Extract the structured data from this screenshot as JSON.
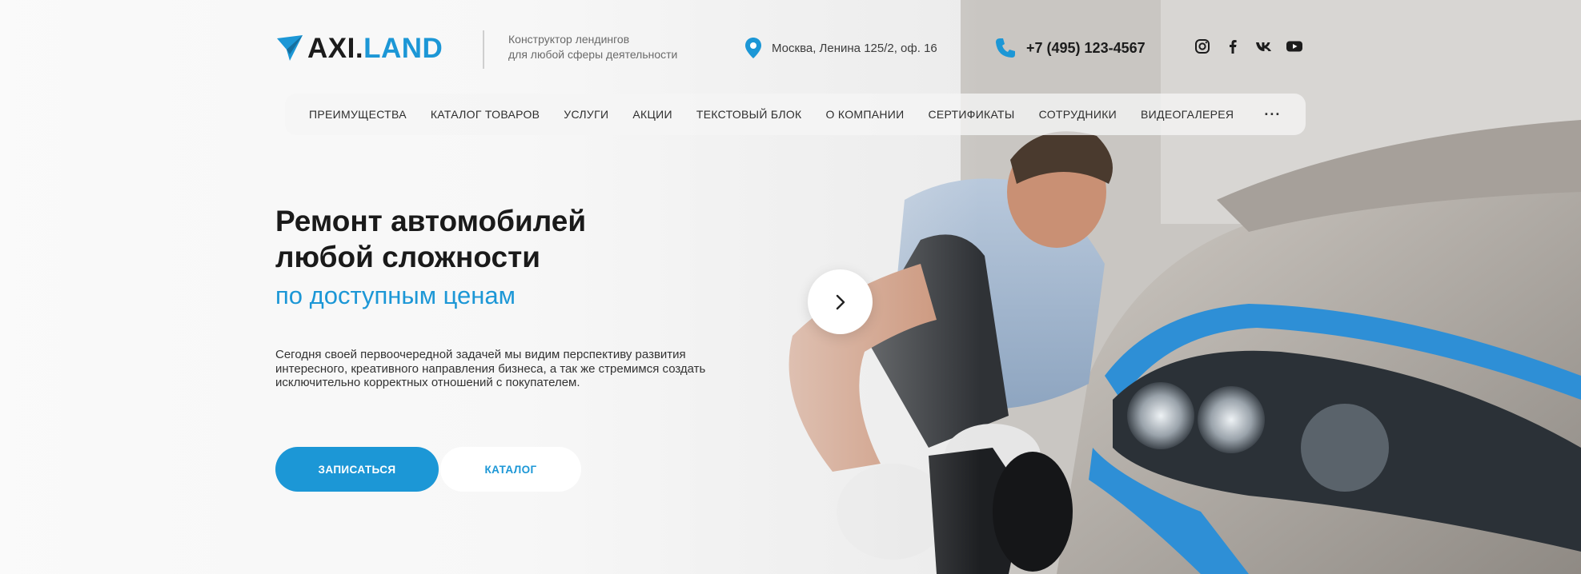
{
  "colors": {
    "accent": "#1c97d6",
    "text": "#1a1a1a"
  },
  "header": {
    "logo": {
      "part1": "AXI.",
      "part2": "LAND",
      "icon": "paper-plane-icon"
    },
    "tagline_line1": "Конструктор лендингов",
    "tagline_line2": "для любой сферы деятельности",
    "address": "Москва, Ленина 125/2, оф. 16",
    "phone": "+7 (495) 123-4567",
    "socials": [
      "instagram-icon",
      "facebook-icon",
      "vk-icon",
      "youtube-icon"
    ]
  },
  "nav": {
    "items": [
      "ПРЕИМУЩЕСТВА",
      "КАТАЛОГ ТОВАРОВ",
      "УСЛУГИ",
      "АКЦИИ",
      "ТЕКСТОВЫЙ БЛОК",
      "О КОМПАНИИ",
      "СЕРТИФИКАТЫ",
      "СОТРУДНИКИ",
      "ВИДЕОГАЛЕРЕЯ"
    ],
    "more": "···"
  },
  "hero": {
    "title_line1": "Ремонт автомобилей",
    "title_line2": "любой сложности",
    "title_accent": "по доступным ценам",
    "description": "Сегодня своей первоочередной задачей мы видим перспективу развития интересного, креативного направления бизнеса, а так же стремимся создать исключительно корректных отношений с покупателем.",
    "primary_button": "ЗАПИСАТЬСЯ",
    "secondary_button": "КАТАЛОГ",
    "slider_next_icon": "chevron-right-icon"
  }
}
